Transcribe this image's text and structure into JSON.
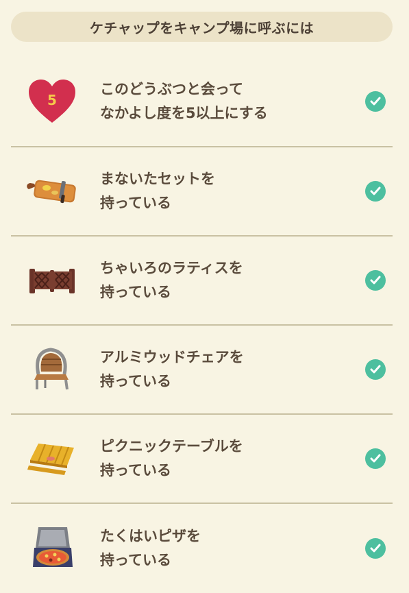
{
  "header": {
    "title": "ケチャップをキャンプ場に呼ぶには"
  },
  "conditions": [
    {
      "line1": "このどうぶつと会って",
      "line2": "なかよし度を5以上にする",
      "icon": "heart-level-icon",
      "badge": "5",
      "completed": true
    },
    {
      "line1": "まないたセットを",
      "line2": "持っている",
      "icon": "cutting-board-icon",
      "completed": true
    },
    {
      "line1": "ちゃいろのラティスを",
      "line2": "持っている",
      "icon": "brown-lattice-icon",
      "completed": true
    },
    {
      "line1": "アルミウッドチェアを",
      "line2": "持っている",
      "icon": "aluminum-wood-chair-icon",
      "completed": true
    },
    {
      "line1": "ピクニックテーブルを",
      "line2": "持っている",
      "icon": "picnic-table-icon",
      "completed": true
    },
    {
      "line1": "たくはいピザを",
      "line2": "持っている",
      "icon": "delivery-pizza-icon",
      "completed": true
    }
  ],
  "colors": {
    "background": "#f8f4e3",
    "header_bg": "#ece3c8",
    "check": "#4dbf9f",
    "heart": "#d22f4e",
    "divider": "#c9c1a3"
  }
}
